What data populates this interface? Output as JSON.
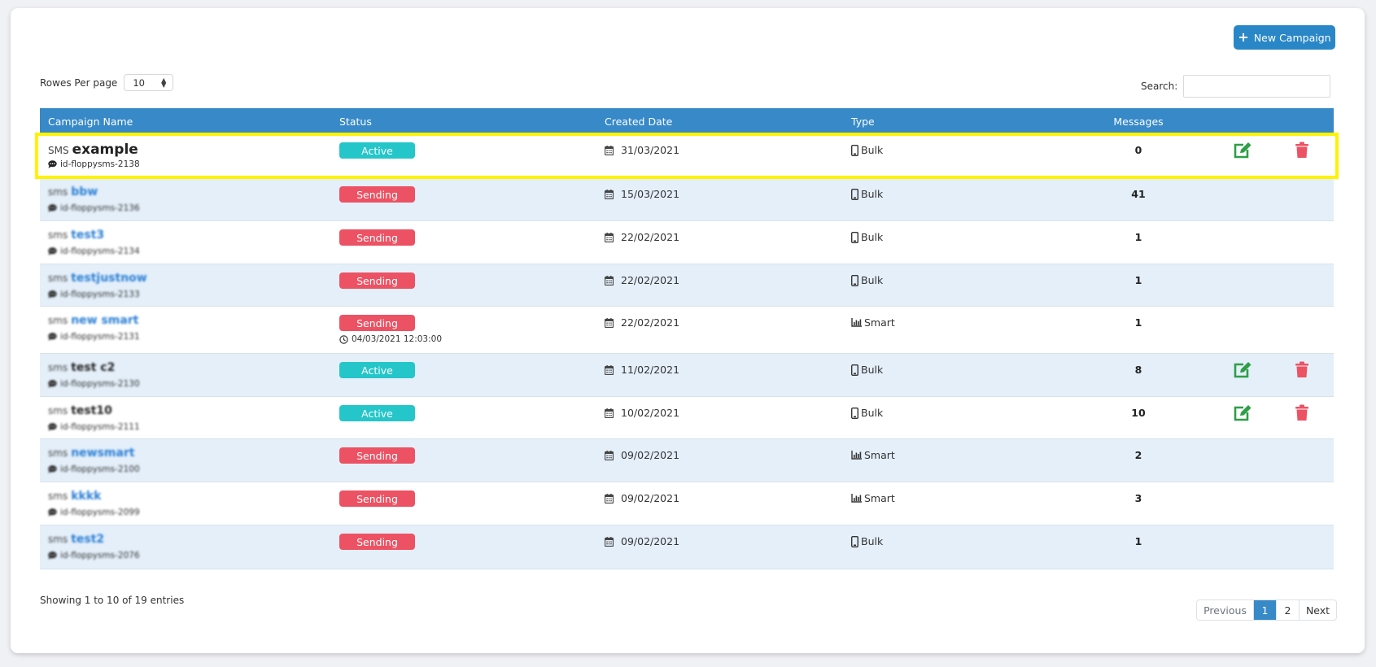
{
  "toolbar": {
    "new_campaign_label": "New Campaign",
    "new_campaign_icon": "plus-icon"
  },
  "controls": {
    "rows_per_page_label": "Rowes Per page",
    "rows_per_page_value": "10",
    "search_label": "Search:",
    "search_value": ""
  },
  "table": {
    "columns": [
      "Campaign Name",
      "Status",
      "Created Date",
      "Type",
      "Messages"
    ],
    "rows": [
      {
        "prefix": "SMS",
        "name": "example",
        "sub": "id-floppysms-2138",
        "status": "Active",
        "schedule": "",
        "date": "31/03/2021",
        "type": "Bulk",
        "messages": "0",
        "actions": true,
        "obscured": false,
        "link": false
      },
      {
        "prefix": "sms",
        "name": "bbw",
        "sub": "id-floppysms-2136",
        "status": "Sending",
        "schedule": "",
        "date": "15/03/2021",
        "type": "Bulk",
        "messages": "41",
        "actions": false,
        "obscured": true,
        "link": true
      },
      {
        "prefix": "sms",
        "name": "test3",
        "sub": "id-floppysms-2134",
        "status": "Sending",
        "schedule": "",
        "date": "22/02/2021",
        "type": "Bulk",
        "messages": "1",
        "actions": false,
        "obscured": true,
        "link": true
      },
      {
        "prefix": "sms",
        "name": "testjustnow",
        "sub": "id-floppysms-2133",
        "status": "Sending",
        "schedule": "",
        "date": "22/02/2021",
        "type": "Bulk",
        "messages": "1",
        "actions": false,
        "obscured": true,
        "link": true
      },
      {
        "prefix": "sms",
        "name": "new smart",
        "sub": "id-floppysms-2131",
        "status": "Sending",
        "schedule": "04/03/2021 12:03:00",
        "date": "22/02/2021",
        "type": "Smart",
        "messages": "1",
        "actions": false,
        "obscured": true,
        "link": true
      },
      {
        "prefix": "sms",
        "name": "test c2",
        "sub": "id-floppysms-2130",
        "status": "Active",
        "schedule": "",
        "date": "11/02/2021",
        "type": "Bulk",
        "messages": "8",
        "actions": true,
        "obscured": true,
        "link": false
      },
      {
        "prefix": "sms",
        "name": "test10",
        "sub": "id-floppysms-2111",
        "status": "Active",
        "schedule": "",
        "date": "10/02/2021",
        "type": "Bulk",
        "messages": "10",
        "actions": true,
        "obscured": true,
        "link": false
      },
      {
        "prefix": "sms",
        "name": "newsmart",
        "sub": "id-floppysms-2100",
        "status": "Sending",
        "schedule": "",
        "date": "09/02/2021",
        "type": "Smart",
        "messages": "2",
        "actions": false,
        "obscured": true,
        "link": true
      },
      {
        "prefix": "sms",
        "name": "kkkk",
        "sub": "id-floppysms-2099",
        "status": "Sending",
        "schedule": "",
        "date": "09/02/2021",
        "type": "Smart",
        "messages": "3",
        "actions": false,
        "obscured": true,
        "link": true
      },
      {
        "prefix": "sms",
        "name": "test2",
        "sub": "id-floppysms-2076",
        "status": "Sending",
        "schedule": "",
        "date": "09/02/2021",
        "type": "Bulk",
        "messages": "1",
        "actions": false,
        "obscured": true,
        "link": true
      }
    ]
  },
  "footer": {
    "showing_text": "Showing 1 to 10 of 19 entries",
    "pagination": {
      "previous": "Previous",
      "pages": [
        "1",
        "2"
      ],
      "current": "1",
      "next": "Next"
    }
  },
  "colors": {
    "header": "#3789c7",
    "primary_button": "#2a87c7",
    "active": "#25c6c9",
    "sending": "#ec5263",
    "edit": "#2e9e47",
    "delete": "#ec5263",
    "highlight": "#fff200"
  }
}
